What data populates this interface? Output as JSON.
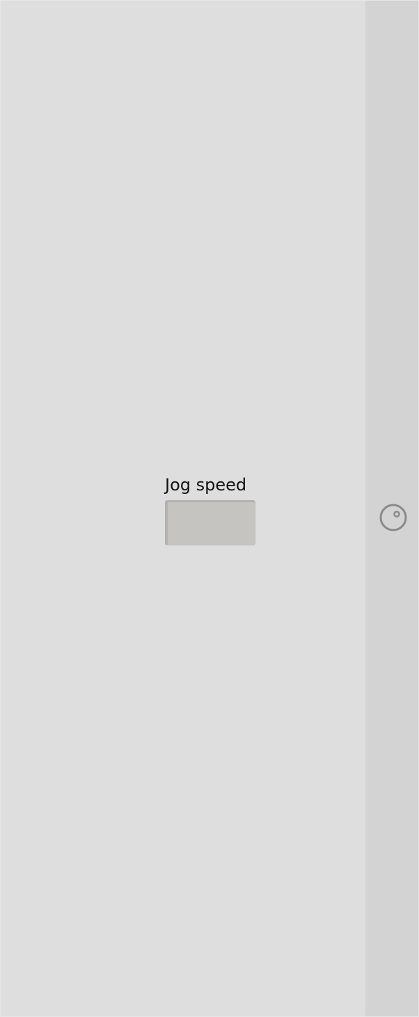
{
  "jog_speed": {
    "label": "Jog speed",
    "value": ""
  },
  "side_control": {
    "icon": "dial-knob-icon"
  },
  "colors": {
    "background": "#dedede",
    "rail": "#d3d3d3",
    "field": "#c5c4c1",
    "icon_stroke": "#8a8a8a"
  }
}
